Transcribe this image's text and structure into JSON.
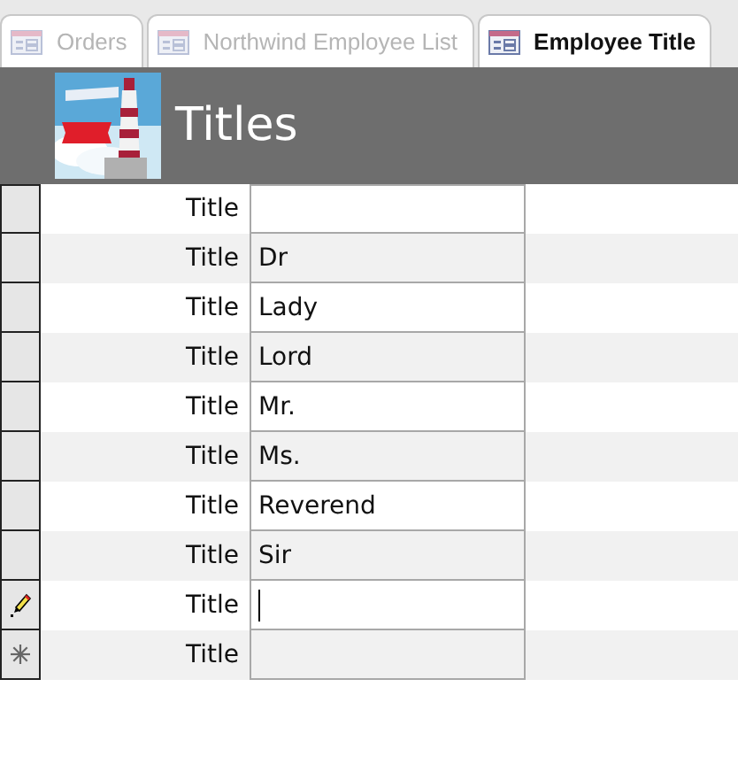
{
  "tabs": [
    {
      "label": "Orders",
      "selected": false
    },
    {
      "label": "Northwind Employee List",
      "selected": false
    },
    {
      "label": "Employee Title",
      "selected": true
    }
  ],
  "header": {
    "title": "Titles"
  },
  "rows": [
    {
      "label": "Title",
      "value": "",
      "kind": "record"
    },
    {
      "label": "Title",
      "value": "Dr",
      "kind": "record"
    },
    {
      "label": "Title",
      "value": "Lady",
      "kind": "record"
    },
    {
      "label": "Title",
      "value": "Lord",
      "kind": "record"
    },
    {
      "label": "Title",
      "value": "Mr.",
      "kind": "record"
    },
    {
      "label": "Title",
      "value": "Ms.",
      "kind": "record"
    },
    {
      "label": "Title",
      "value": "Reverend",
      "kind": "record"
    },
    {
      "label": "Title",
      "value": "Sir",
      "kind": "record"
    },
    {
      "label": "Title",
      "value": "",
      "kind": "editing"
    },
    {
      "label": "Title",
      "value": "",
      "kind": "new"
    }
  ]
}
